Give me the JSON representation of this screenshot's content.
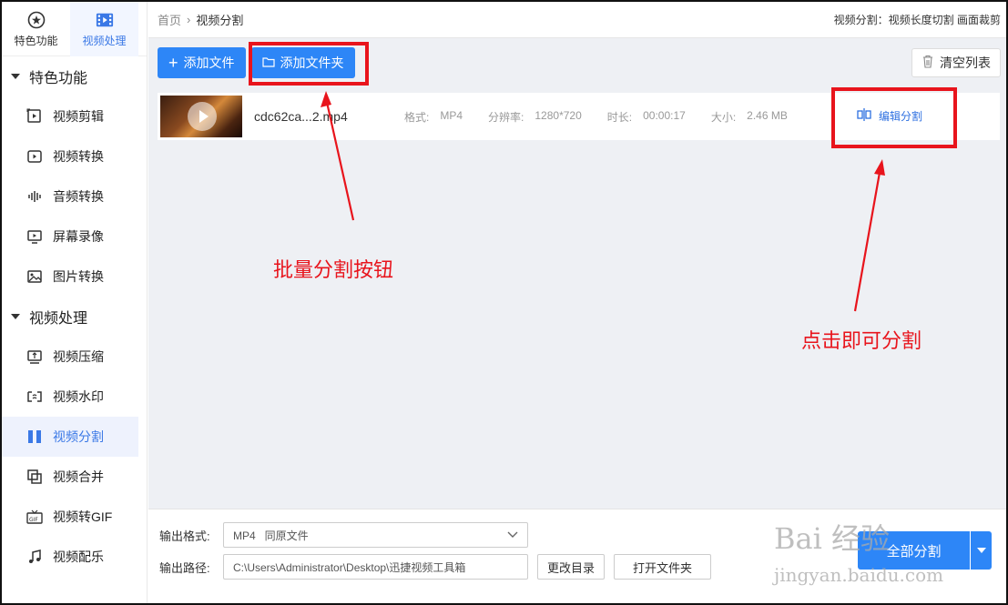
{
  "sidebar": {
    "top_tabs": [
      {
        "label": "特色功能",
        "icon": "star-circle-icon"
      },
      {
        "label": "视频处理",
        "icon": "film-icon"
      }
    ],
    "groups": [
      {
        "title": "特色功能",
        "items": [
          {
            "label": "视频剪辑",
            "icon": "video-edit-icon"
          },
          {
            "label": "视频转换",
            "icon": "video-convert-icon"
          },
          {
            "label": "音频转换",
            "icon": "audio-wave-icon"
          },
          {
            "label": "屏幕录像",
            "icon": "screen-record-icon"
          },
          {
            "label": "图片转换",
            "icon": "image-icon"
          }
        ]
      },
      {
        "title": "视频处理",
        "items": [
          {
            "label": "视频压缩",
            "icon": "compress-icon"
          },
          {
            "label": "视频水印",
            "icon": "watermark-icon"
          },
          {
            "label": "视频分割",
            "icon": "split-icon"
          },
          {
            "label": "视频合并",
            "icon": "merge-icon"
          },
          {
            "label": "视频转GIF",
            "icon": "gif-icon"
          },
          {
            "label": "视频配乐",
            "icon": "music-icon"
          }
        ]
      }
    ]
  },
  "header": {
    "breadcrumb_home": "首页",
    "breadcrumb_sep": "›",
    "breadcrumb_current": "视频分割",
    "info": "视频分割：视频长度切割 画面裁剪"
  },
  "toolbar": {
    "add_file": "添加文件",
    "add_folder": "添加文件夹",
    "clear_list": "清空列表"
  },
  "file": {
    "name": "cdc62ca...2.mp4",
    "format_label": "格式:",
    "format_value": "MP4",
    "resolution_label": "分辨率:",
    "resolution_value": "1280*720",
    "duration_label": "时长:",
    "duration_value": "00:00:17",
    "size_label": "大小:",
    "size_value": "2.46 MB",
    "edit_split": "编辑分割"
  },
  "bottom": {
    "format_label": "输出格式:",
    "format_value": "MP4   同原文件",
    "path_label": "输出路径:",
    "path_value": "C:\\Users\\Administrator\\Desktop\\迅捷视频工具箱",
    "change_dir": "更改目录",
    "open_folder": "打开文件夹",
    "split_all": "全部分割"
  },
  "annotations": {
    "batch_label": "批量分割按钮",
    "click_label": "点击即可分割",
    "color": "#e8141c"
  },
  "watermark": {
    "line1": "Bai 经验",
    "line2": "jingyan.baidu.com"
  },
  "colors": {
    "primary": "#2d86f7",
    "active_bg": "#eef2fd",
    "link": "#2d6fe0"
  }
}
